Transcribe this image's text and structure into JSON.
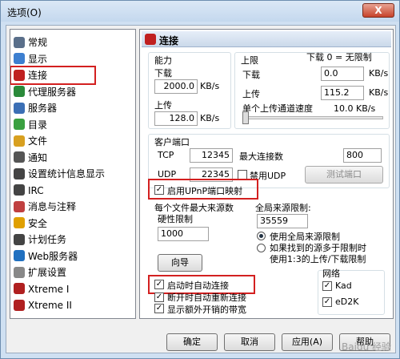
{
  "window": {
    "title": "选项(O)",
    "close": "X"
  },
  "sidebar": {
    "items": [
      {
        "label": "常规",
        "color": "#5a6f8a"
      },
      {
        "label": "显示",
        "color": "#3d7fd0"
      },
      {
        "label": "连接",
        "color": "#c02020"
      },
      {
        "label": "代理服务器",
        "color": "#2a8a3a"
      },
      {
        "label": "服务器",
        "color": "#3b6fb5"
      },
      {
        "label": "目录",
        "color": "#3aa040"
      },
      {
        "label": "文件",
        "color": "#d8a020"
      },
      {
        "label": "通知",
        "color": "#555555"
      },
      {
        "label": "设置统计信息显示",
        "color": "#444444"
      },
      {
        "label": "IRC",
        "color": "#444444"
      },
      {
        "label": "消息与注释",
        "color": "#c04040"
      },
      {
        "label": "安全",
        "color": "#e0a000"
      },
      {
        "label": "计划任务",
        "color": "#444444"
      },
      {
        "label": "Web服务器",
        "color": "#2070c0"
      },
      {
        "label": "扩展设置",
        "color": "#888888"
      },
      {
        "label": "Xtreme I",
        "color": "#b02020"
      },
      {
        "label": "Xtreme II",
        "color": "#b02020"
      }
    ]
  },
  "panel": {
    "title": "连接",
    "capacity": {
      "label": "能力",
      "download_label": "下载",
      "download_value": "2000.0",
      "upload_label": "上传",
      "upload_value": "128.0",
      "unit": "KB/s"
    },
    "limits": {
      "label": "上限",
      "note": "下载 0 = 无限制",
      "download_label": "下载",
      "download_value": "0.0",
      "upload_label": "上传",
      "upload_value": "115.2",
      "unit": "KB/s",
      "single_upload_label": "单个上传通道速度",
      "single_upload_value": "10.0 KB/s"
    },
    "client_port": {
      "label": "客户端口",
      "tcp_label": "TCP",
      "tcp_value": "12345",
      "udp_label": "UDP",
      "udp_value": "22345",
      "max_conn_label": "最大连接数",
      "max_conn_value": "800",
      "disable_udp_label": "禁用UDP",
      "test_port_label": "测试端口"
    },
    "upnp_label": "启用UPnP端口映射",
    "per_file": {
      "label1": "每个文件最大来源数",
      "label2": "硬性限制",
      "value": "1000"
    },
    "global": {
      "label": "全局来源限制:",
      "value": "35559",
      "opt1": "使用全局来源限制",
      "opt2a": "如果找到的源多于限制时",
      "opt2b": "使用1:3的上传/下载限制"
    },
    "wizard_label": "向导",
    "auto_connect_label": "启动时自动连接",
    "reconnect_label": "断开时自动重新连接",
    "show_overhead_label": "显示额外开销的带宽",
    "network": {
      "label": "网络",
      "kad_label": "Kad",
      "ed2k_label": "eD2K"
    }
  },
  "footer": {
    "ok": "确定",
    "cancel": "取消",
    "apply": "应用(A)",
    "help": "帮助"
  },
  "watermark": "Baidu 经验"
}
